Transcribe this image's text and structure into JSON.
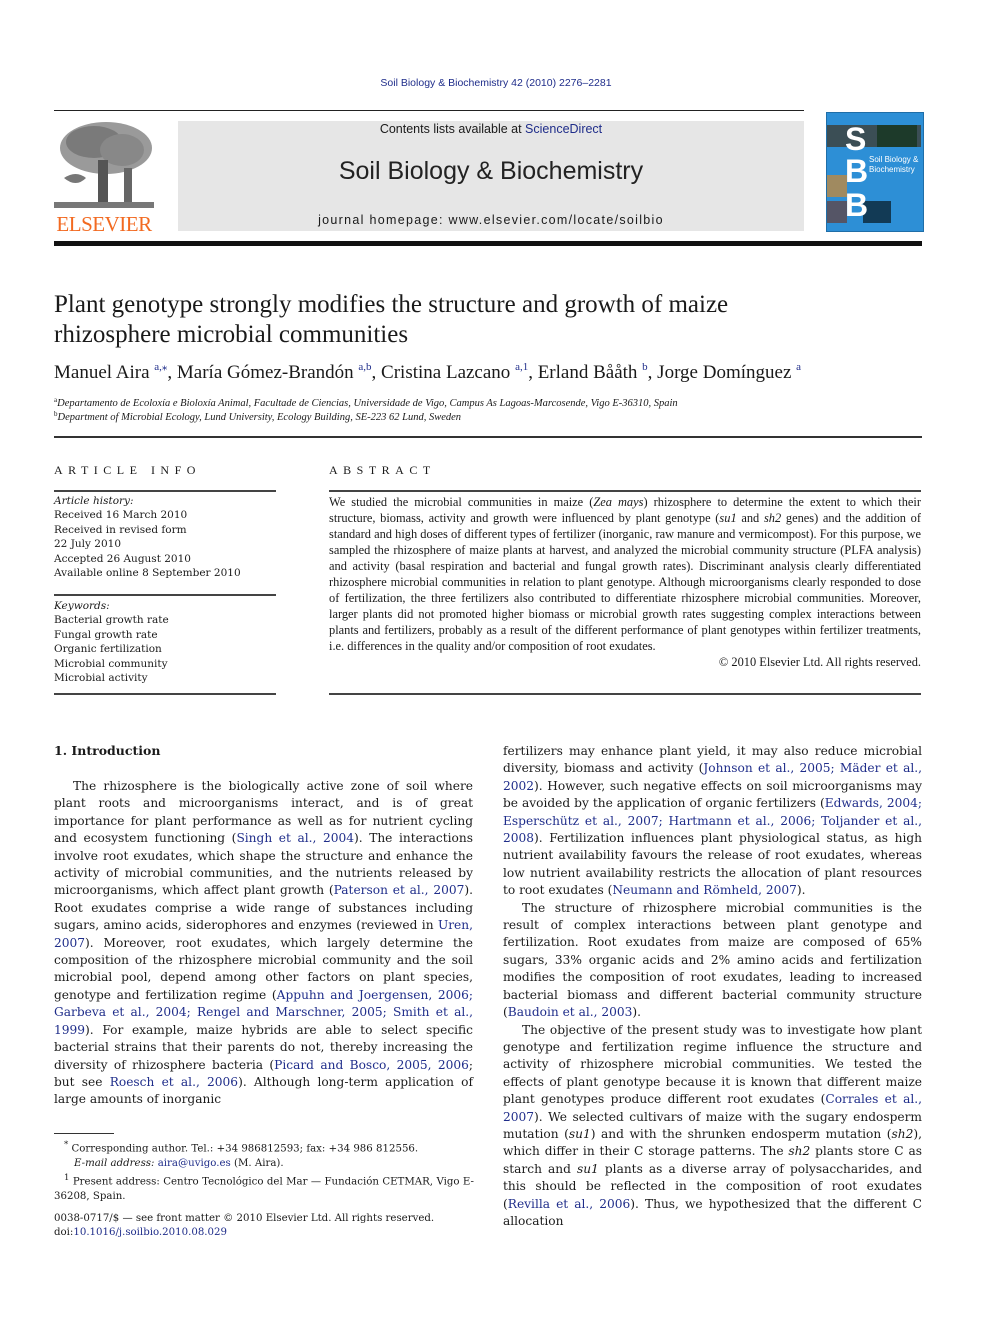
{
  "header": {
    "journal_ref": "Soil Biology & Biochemistry 42 (2010) 2276–2281",
    "contents_prefix": "Contents lists available at ",
    "contents_link": "ScienceDirect",
    "journal_title": "Soil Biology & Biochemistry",
    "homepage": "journal homepage: www.elsevier.com/locate/soilbio",
    "publisher_logo_text": "ELSEVIER",
    "cover": {
      "letters": [
        "S",
        "B",
        "B"
      ],
      "title_line1": "Soil Biology &",
      "title_line2": "Biochemistry",
      "color": "#2d8fd6"
    },
    "colors": {
      "link": "#1f2d8a",
      "elsevier_orange": "#f26a21",
      "masthead_bg": "#e6e6e6"
    }
  },
  "article": {
    "title_line1": "Plant genotype strongly modifies the structure and growth of maize",
    "title_line2": "rhizosphere microbial communities",
    "authors": [
      {
        "name": "Manuel Aira",
        "sup": "a,⁎",
        "sep": ", "
      },
      {
        "name": "María Gómez-Brandón",
        "sup": "a,b",
        "sep": ", "
      },
      {
        "name": "Cristina Lazcano",
        "sup": "a,1",
        "sep": ", "
      },
      {
        "name": "Erland Bååth",
        "sup": "b",
        "sep": ", "
      },
      {
        "name": "Jorge Domínguez",
        "sup": "a",
        "sep": ""
      }
    ],
    "affiliations": [
      {
        "label": "a",
        "text": "Departamento de Ecoloxía e Bioloxía Animal, Facultade de Ciencias, Universidade de Vigo, Campus As Lagoas-Marcosende, Vigo E-36310, Spain"
      },
      {
        "label": "b",
        "text": "Department of Microbial Ecology, Lund University, Ecology Building, SE-223 62 Lund, Sweden"
      }
    ]
  },
  "article_info": {
    "heading": "ARTICLE INFO",
    "history_label": "Article history:",
    "history": [
      "Received 16 March 2010",
      "Received in revised form",
      "22 July 2010",
      "Accepted 26 August 2010",
      "Available online 8 September 2010"
    ],
    "keywords_label": "Keywords:",
    "keywords": [
      "Bacterial growth rate",
      "Fungal growth rate",
      "Organic fertilization",
      "Microbial community",
      "Microbial activity"
    ]
  },
  "abstract": {
    "heading": "ABSTRACT",
    "parts": {
      "p1": "We studied the microbial communities in maize (",
      "i1": "Zea mays",
      "p2": ") rhizosphere to determine the extent to which their structure, biomass, activity and growth were influenced by plant genotype (",
      "i2": "su1",
      "p3": " and ",
      "i3": "sh2",
      "p4": " genes) and the addition of standard and high doses of different types of fertilizer (inorganic, raw manure and ver­micompost). For this purpose, we sampled the rhizosphere of maize plants at harvest, and analyzed the microbial community structure (PLFA analysis) and activity (basal respiration and bacterial and fungal growth rates). Discriminant analysis clearly differentiated rhizosphere microbial communities in relation to plant genotype. Although microorganisms clearly responded to dose of fertilization, the three fertilizers also contributed to differentiate rhizosphere microbial communities. Moreover, larger plants did not promoted higher biomass or microbial growth rates suggesting complex interactions between plants and fertilizers, probably as a result of the different performance of plant genotypes within fertilizer treatments, i.e. differences in the quality and/or composition of root exudates."
    },
    "copyright": "© 2010 Elsevier Ltd. All rights reserved."
  },
  "body": {
    "section_heading": "1.  Introduction",
    "left": {
      "p1a": "The rhizosphere is the biologically active zone of soil where plant roots and microorganisms interact, and is of great importance for plant performance as well as for nutrient cycling and ecosystem functioning (",
      "c1": "Singh et al., 2004",
      "p1b": "). The interactions involve root exudates, which shape the structure and enhance the activity of microbial communities, and the nutrients released by microor­ganisms, which affect plant growth (",
      "c2": "Paterson et al., 2007",
      "p1c": "). Root exudates comprise a wide range of substances including sugars, amino acids, siderophores and enzymes (reviewed in ",
      "c3": "Uren, 2007",
      "p1d": "). Moreover, root exudates, which largely determine the composition of the rhizosphere microbial community and the soil microbial pool, depend among other factors on plant species, genotype and fertil­ization regime (",
      "c4": "Appuhn and Joergensen, 2006; Garbeva et al., 2004; Rengel and Marschner, 2005; Smith et al., 1999",
      "p1e": "). For example, maize hybrids are able to select specific bacterial strains that their parents do not, thereby increasing the diversity of rhizosphere bacteria (",
      "c5": "Picard and Bosco, 2005, 2006",
      "p1f": "; but see ",
      "c6": "Roesch et al., 2006",
      "p1g": "). Although long-term application of large amounts of inorganic"
    },
    "right": {
      "p1a": "fertilizers may enhance plant yield, it may also reduce microbial diversity, biomass and activity (",
      "c1": "Johnson et al., 2005; Mäder et al., 2002",
      "p1b": "). However, such negative effects on soil microorganisms may be avoided by the application of organic fertilizers (",
      "c2": "Edwards, 2004; Esperschütz et al., 2007; Hartmann et al., 2006; Toljander et al., 2008",
      "p1c": "). Fertilization influences plant physiological status, as high nutrient availability favours the release of root exudates, whereas low nutrient availability restricts the allocation of plant resources to root exudates (",
      "c3": "Neumann and Römheld, 2007",
      "p1d": ").",
      "p2a": "The structure of rhizosphere microbial communities is the result of complex interactions between plant genotype and fertilization. Root exudates from maize are composed of 65% sugars, 33% organic acids and 2% amino acids and fertilization modifies the composition of root exudates, leading to increased bacterial biomass and different bacterial community structure (",
      "c4": "Baudoin et al., 2003",
      "p2b": ").",
      "p3a": "The objective of the present study was to investigate how plant genotype and fertilization regime influence the structure and activity of rhizosphere microbial communities. We tested the effects of plant genotype because it is known that different maize plant genotypes produce different root exudates (",
      "c5": "Corrales et al., 2007",
      "p3b": "). We selected cultivars of maize with the sugary endosperm mutation (",
      "i1": "su1",
      "p3c": ") and with the shrunken endosperm mutation (",
      "i2": "sh2",
      "p3d": "), which differ in their C storage patterns. The ",
      "i3": "sh2",
      "p3e": " plants store C as starch and ",
      "i4": "su1",
      "p3f": " plants as a diverse array of polysaccharides, and this should be reflected in the composition of root exudates (",
      "c6": "Revilla et al., 2006",
      "p3g": "). Thus, we hypothesized that the different C allocation"
    }
  },
  "footnotes": {
    "corresponding_mark": "*",
    "corresponding": "Corresponding author. Tel.: +34 986812593; fax: +34 986 812556.",
    "email_label": "E-mail address:",
    "email": "aira@uvigo.es",
    "email_suffix": " (M. Aira).",
    "present_mark": "1",
    "present": "Present address: Centro Tecnológico del Mar — Fundación CETMAR, Vigo E-36208, Spain.",
    "issn_line": "0038-0717/$ — see front matter © 2010 Elsevier Ltd. All rights reserved.",
    "doi_prefix": "doi:",
    "doi": "10.1016/j.soilbio.2010.08.029"
  }
}
